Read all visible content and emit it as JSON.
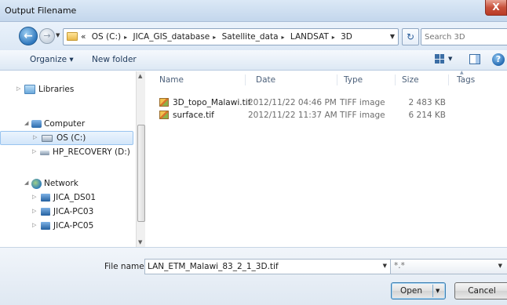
{
  "window": {
    "title": "Output Filename",
    "close_label": "X"
  },
  "address": {
    "crumbs": [
      "OS (C:)",
      "JICA_GIS_database",
      "Satellite_data",
      "LANDSAT",
      "3D"
    ],
    "lead_marker": "«",
    "separator": "▸",
    "search_placeholder": "Search 3D"
  },
  "toolbar": {
    "organize_label": "Organize ▾",
    "new_folder_label": "New folder"
  },
  "nav": {
    "libraries": "Libraries",
    "computer": "Computer",
    "os_c": "OS (C:)",
    "hp_recovery": "HP_RECOVERY (D:)",
    "network": "Network",
    "pcs": [
      "JICA_DS01",
      "JICA-PC03",
      "JICA-PC05"
    ]
  },
  "columns": {
    "name": "Name",
    "date": "Date",
    "type": "Type",
    "size": "Size",
    "tags": "Tags"
  },
  "files": [
    {
      "name": "3D_topo_Malawi.tif",
      "date": "2012/11/22 04:46 PM",
      "type": "TIFF image",
      "size": "2 483 KB"
    },
    {
      "name": "surface.tif",
      "date": "2012/11/22 11:37 AM",
      "type": "TIFF image",
      "size": "6 214 KB"
    }
  ],
  "bottom": {
    "filename_label": "File name:",
    "filename_value": "LAN_ETM_Malawi_83_2_1_3D.tif",
    "filetype_value": "*.*",
    "open_label": "Open",
    "cancel_label": "Cancel"
  }
}
